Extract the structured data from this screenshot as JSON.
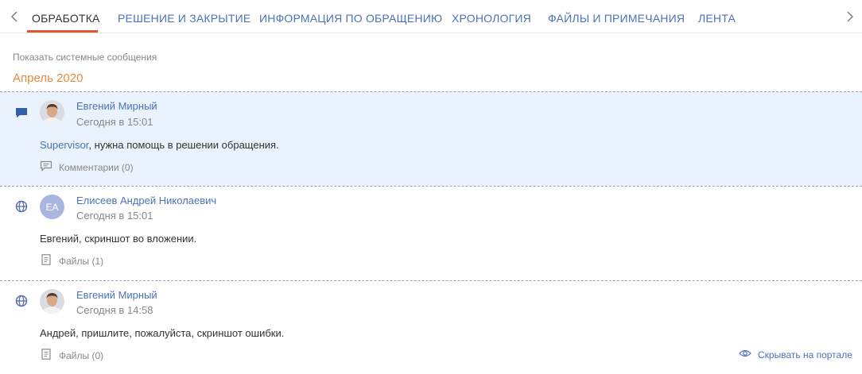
{
  "tabs": [
    {
      "label": "ОБРАБОТКА",
      "active": true
    },
    {
      "label": "РЕШЕНИЕ И ЗАКРЫТИЕ",
      "active": false
    },
    {
      "label": "ИНФОРМАЦИЯ ПО ОБРАЩЕНИЮ",
      "active": false
    },
    {
      "label": "ХРОНОЛОГИЯ",
      "active": false
    },
    {
      "label": "ФАЙЛЫ И ПРИМЕЧАНИЯ",
      "active": false
    },
    {
      "label": "ЛЕНТА",
      "active": false
    }
  ],
  "feed": {
    "show_system_messages": "Показать системные сообщения",
    "month_header": "Апрель 2020",
    "posts": [
      {
        "icon": "message-icon",
        "author": "Евгений Мирный",
        "time": "Сегодня в 15:01",
        "mention": "Supervisor",
        "text": ", нужна помощь в решении обращения.",
        "footer": "Комментарии (0)",
        "footer_icon": "comment-icon"
      },
      {
        "icon": "globe-icon",
        "author": "Елисеев Андрей Николаевич",
        "avatar_initials": "ЕА",
        "time": "Сегодня в 15:01",
        "text": "Евгений, скриншот во вложении.",
        "footer": "Файлы (1)",
        "footer_icon": "file-icon"
      },
      {
        "icon": "globe-icon",
        "author": "Евгений Мирный",
        "time": "Сегодня в 14:58",
        "text": "Андрей, пришлите, пожалуйста, скриншот ошибки.",
        "footer": "Файлы (0)",
        "footer_icon": "file-icon",
        "portal_action": "Скрывать на портале"
      }
    ]
  },
  "colors": {
    "accent": "#e0582f",
    "link": "#4b72b8",
    "month": "#e48a3e",
    "highlight": "#eaf3fd"
  }
}
